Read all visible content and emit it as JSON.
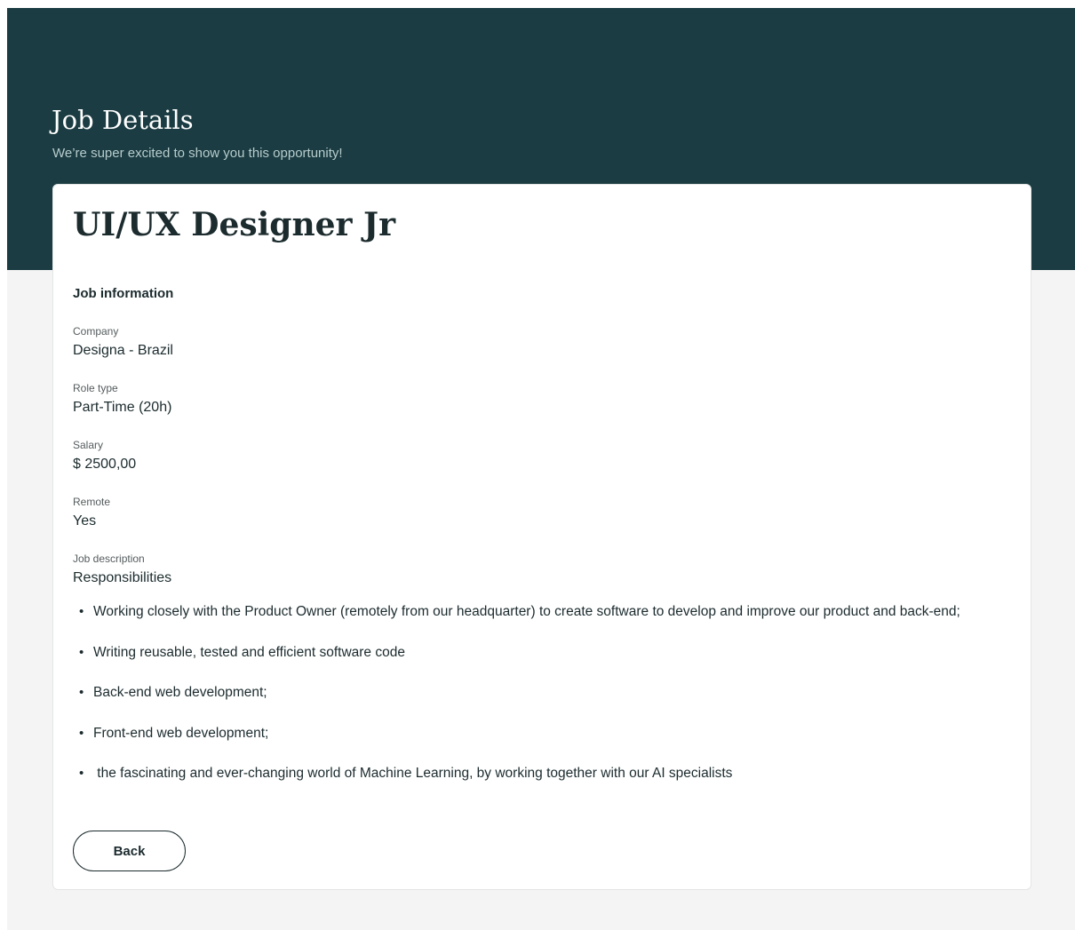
{
  "header": {
    "title": "Job Details",
    "subtitle": "We’re super excited to show you this opportunity!"
  },
  "job": {
    "title": "UI/UX Designer Jr",
    "section_heading": "Job information",
    "fields": [
      {
        "label": "Company",
        "value": "Designa - Brazil"
      },
      {
        "label": "Role type",
        "value": "Part-Time (20h)"
      },
      {
        "label": "Salary",
        "value": "$ 2500,00"
      },
      {
        "label": "Remote",
        "value": "Yes"
      },
      {
        "label": "Job description",
        "value": "Responsibilities"
      }
    ],
    "responsibilities": [
      "Working closely with the Product Owner (remotely from our headquarter) to create software to develop and improve our product and back-end;",
      "Writing reusable, tested and efficient software code",
      "Back-end web development;",
      "Front-end web development;",
      " the fascinating and ever-changing world of Machine Learning, by working together with our AI specialists"
    ]
  },
  "actions": {
    "back_label": "Back"
  },
  "colors": {
    "header_background": "#1a3c42",
    "page_background": "#f4f4f4",
    "card_background": "#ffffff",
    "text_primary": "#1c2b2e"
  },
  "icons": {
    "list_bullet": "bullet-icon"
  }
}
